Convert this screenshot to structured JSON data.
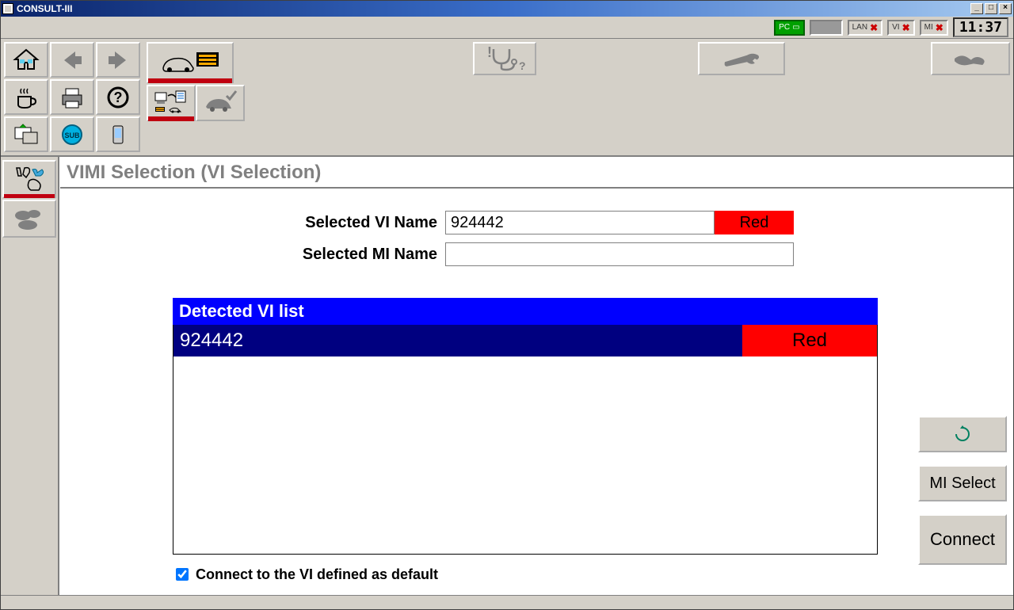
{
  "window": {
    "title": "CONSULT-III"
  },
  "status": {
    "pc_label": "PC",
    "lan_label": "LAN",
    "vi_label": "VI",
    "mi_label": "MI",
    "clock": "11:37"
  },
  "page": {
    "title": "VIMI Selection (VI Selection)"
  },
  "fields": {
    "vi_label": "Selected VI Name",
    "vi_value": "924442",
    "vi_color_label": "Red",
    "vi_color": "#ff0000",
    "mi_label": "Selected MI Name",
    "mi_value": ""
  },
  "list": {
    "title": "Detected VI list",
    "rows": [
      {
        "name": "924442",
        "color_label": "Red",
        "color": "#ff0000",
        "selected": true
      }
    ]
  },
  "checkbox": {
    "label": "Connect to the VI defined as default",
    "checked": true
  },
  "buttons": {
    "refresh_tooltip": "Refresh",
    "mi_select": "MI Select",
    "connect": "Connect"
  }
}
